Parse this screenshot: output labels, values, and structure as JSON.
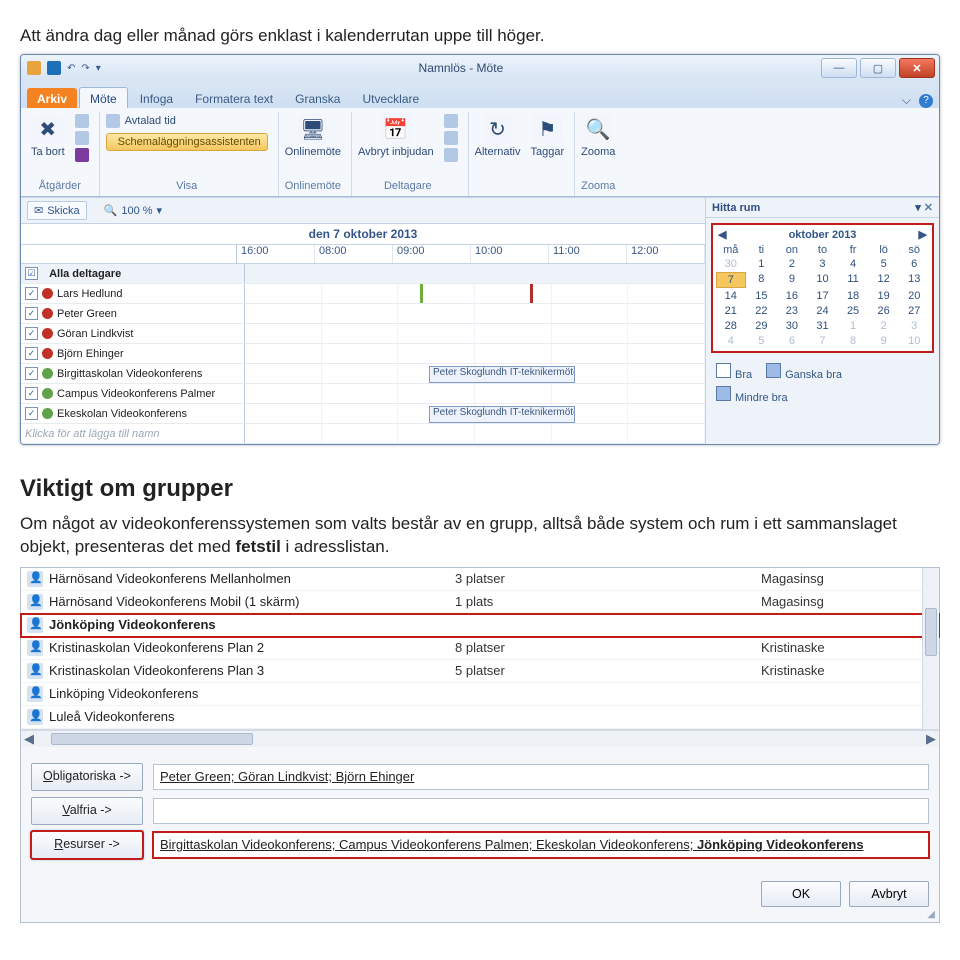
{
  "doc": {
    "intro": "Att ändra dag eller månad görs enklast i kalenderrutan uppe till höger.",
    "heading": "Viktigt om grupper",
    "body_pre": "Om något av videokonferenssystemen som valts består av en grupp, alltså både system och rum i ett sammanslaget objekt, presenteras det med ",
    "body_bold": "fetstil",
    "body_post": " i adresslistan."
  },
  "window": {
    "title": "Namnlös  -  Möte",
    "tabs": {
      "arkiv": "Arkiv",
      "mote": "Möte",
      "infoga": "Infoga",
      "formatera": "Formatera text",
      "granska": "Granska",
      "utvecklare": "Utvecklare"
    },
    "ribbon": {
      "g1": {
        "tabort": "Ta bort",
        "label": "Åtgärder"
      },
      "g2": {
        "avtalad": "Avtalad tid",
        "schema": "Schemaläggningsassistenten",
        "label": "Visa"
      },
      "g3": {
        "online": "Onlinemöte",
        "label": "Onlinemöte"
      },
      "g4": {
        "avbryt": "Avbryt inbjudan",
        "label": "Deltagare"
      },
      "g5": {
        "alt": "Alternativ",
        "tag": "Taggar"
      },
      "g6": {
        "zoom": "Zooma",
        "label": "Zooma"
      }
    },
    "toolbar2": {
      "skicka": "Skicka",
      "zoom": "100 %"
    },
    "date_header": "den 7 oktober 2013",
    "times": [
      "16:00",
      "08:00",
      "09:00",
      "10:00",
      "11:00",
      "12:00"
    ],
    "attendees_header": "Alla deltagare",
    "attendees": [
      {
        "name": "Lars Hedlund",
        "dot": "red"
      },
      {
        "name": "Peter Green",
        "dot": "red"
      },
      {
        "name": "Göran Lindkvist",
        "dot": "red"
      },
      {
        "name": "Björn Ehinger",
        "dot": "red"
      },
      {
        "name": "Birgittaskolan Videokonferens",
        "dot": "green",
        "evt": "Peter Skoglundh IT-teknikermöte"
      },
      {
        "name": "Campus Videokonferens Palmer",
        "dot": "green"
      },
      {
        "name": "Ekeskolan Videokonferens",
        "dot": "green",
        "evt": "Peter Skoglundh IT-teknikermöte"
      }
    ],
    "placeholder_row": "Klicka för att lägga till namn",
    "find_room": "Hitta rum",
    "month": "oktober 2013",
    "dow": [
      "må",
      "ti",
      "on",
      "to",
      "fr",
      "lö",
      "sö"
    ],
    "weeks": [
      [
        "30",
        "1",
        "2",
        "3",
        "4",
        "5",
        "6"
      ],
      [
        "7",
        "8",
        "9",
        "10",
        "11",
        "12",
        "13"
      ],
      [
        "14",
        "15",
        "16",
        "17",
        "18",
        "19",
        "20"
      ],
      [
        "21",
        "22",
        "23",
        "24",
        "25",
        "26",
        "27"
      ],
      [
        "28",
        "29",
        "30",
        "31",
        "1",
        "2",
        "3"
      ],
      [
        "4",
        "5",
        "6",
        "7",
        "8",
        "9",
        "10"
      ]
    ],
    "legend": {
      "bra": "Bra",
      "ganska": "Ganska bra",
      "mindre": "Mindre bra"
    }
  },
  "addr": {
    "rows": [
      {
        "name": "Härnösand Videokonferens Mellanholmen",
        "cap": "3 platser",
        "loc": "Magasinsg"
      },
      {
        "name": "Härnösand Videokonferens Mobil (1 skärm)",
        "cap": "1 plats",
        "loc": "Magasinsg"
      },
      {
        "name": "Jönköping Videokonferens",
        "cap": "",
        "loc": "",
        "bold": true,
        "hl": true
      },
      {
        "name": "Kristinaskolan Videokonferens Plan 2",
        "cap": "8 platser",
        "loc": "Kristinaske"
      },
      {
        "name": "Kristinaskolan Videokonferens Plan 3",
        "cap": "5 platser",
        "loc": "Kristinaske"
      },
      {
        "name": "Linköping Videokonferens",
        "cap": "",
        "loc": ""
      },
      {
        "name": "Luleå Videokonferens",
        "cap": "",
        "loc": ""
      }
    ],
    "oblig_label": "Obligatoriska ->",
    "oblig_value": "Peter Green; Göran Lindkvist; Björn Ehinger",
    "valfria_label": "Valfria ->",
    "valfria_value": "",
    "resurser_label": "Resurser ->",
    "resurser_value_pre": "Birgittaskolan Videokonferens; Campus Videokonferens Palmen; Ekeskolan Videokonferens; ",
    "resurser_value_bold": "Jönköping Videokonferens",
    "ok": "OK",
    "avbryt": "Avbryt"
  }
}
